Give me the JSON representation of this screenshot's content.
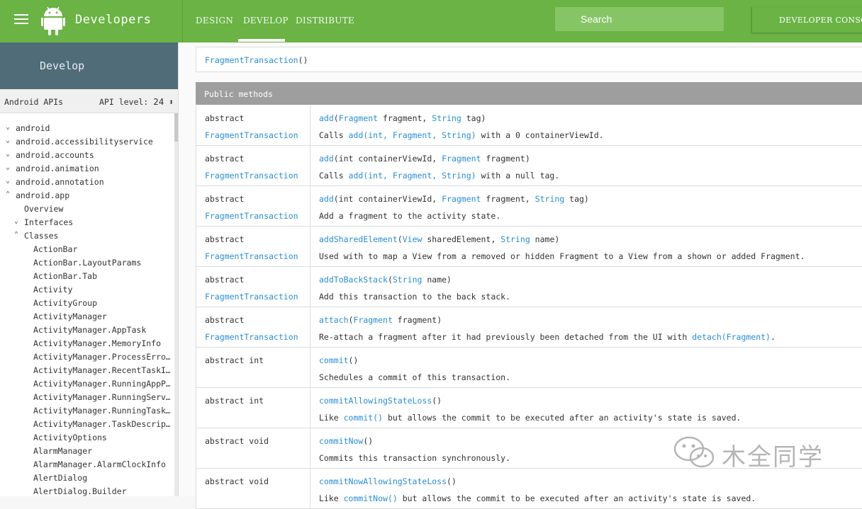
{
  "header": {
    "brand": "Developers",
    "tabs": [
      "DESIGN",
      "DEVELOP",
      "DISTRIBUTE"
    ],
    "active_tab": "DEVELOP",
    "search_placeholder": "Search",
    "console_label": "DEVELOPER CONSOLE",
    "color": "#6ab344"
  },
  "sidebar": {
    "section_title": "Develop",
    "api_label": "Android APIs",
    "api_level_label": "API level:",
    "api_level_value": "24",
    "items": [
      {
        "label": "android",
        "indent": 0,
        "chev": "down"
      },
      {
        "label": "android.accessibilityservice",
        "indent": 0,
        "chev": "down"
      },
      {
        "label": "android.accounts",
        "indent": 0,
        "chev": "down"
      },
      {
        "label": "android.animation",
        "indent": 0,
        "chev": "down"
      },
      {
        "label": "android.annotation",
        "indent": 0,
        "chev": "down"
      },
      {
        "label": "android.app",
        "indent": 0,
        "chev": "up"
      },
      {
        "label": "Overview",
        "indent": 1,
        "chev": ""
      },
      {
        "label": "Interfaces",
        "indent": 1,
        "chev": "down"
      },
      {
        "label": "Classes",
        "indent": 1,
        "chev": "up"
      },
      {
        "label": "ActionBar",
        "indent": 2,
        "chev": ""
      },
      {
        "label": "ActionBar.LayoutParams",
        "indent": 2,
        "chev": ""
      },
      {
        "label": "ActionBar.Tab",
        "indent": 2,
        "chev": ""
      },
      {
        "label": "Activity",
        "indent": 2,
        "chev": ""
      },
      {
        "label": "ActivityGroup",
        "indent": 2,
        "chev": ""
      },
      {
        "label": "ActivityManager",
        "indent": 2,
        "chev": ""
      },
      {
        "label": "ActivityManager.AppTask",
        "indent": 2,
        "chev": ""
      },
      {
        "label": "ActivityManager.MemoryInfo",
        "indent": 2,
        "chev": ""
      },
      {
        "label": "ActivityManager.ProcessErro…",
        "indent": 2,
        "chev": ""
      },
      {
        "label": "ActivityManager.RecentTaskI…",
        "indent": 2,
        "chev": ""
      },
      {
        "label": "ActivityManager.RunningAppP…",
        "indent": 2,
        "chev": ""
      },
      {
        "label": "ActivityManager.RunningServ…",
        "indent": 2,
        "chev": ""
      },
      {
        "label": "ActivityManager.RunningTask…",
        "indent": 2,
        "chev": ""
      },
      {
        "label": "ActivityManager.TaskDescrip…",
        "indent": 2,
        "chev": ""
      },
      {
        "label": "ActivityOptions",
        "indent": 2,
        "chev": ""
      },
      {
        "label": "AlarmManager",
        "indent": 2,
        "chev": ""
      },
      {
        "label": "AlarmManager.AlarmClockInfo",
        "indent": 2,
        "chev": ""
      },
      {
        "label": "AlertDialog",
        "indent": 2,
        "chev": ""
      },
      {
        "label": "AlertDialog.Builder",
        "indent": 2,
        "chev": ""
      }
    ]
  },
  "content": {
    "constructor": {
      "name": "FragmentTransaction",
      "suffix": "()"
    },
    "public_methods_title": "Public methods",
    "methods": [
      {
        "ret1": "abstract",
        "ret2": "FragmentTransaction",
        "sig": [
          [
            "add",
            "l"
          ],
          [
            "(",
            ""
          ],
          [
            "Fragment",
            "l"
          ],
          [
            " fragment, ",
            "b"
          ],
          [
            "String",
            "l"
          ],
          [
            " tag",
            "b"
          ],
          [
            ")",
            ""
          ]
        ],
        "desc": [
          [
            "Calls ",
            ""
          ],
          [
            "add(int, Fragment, String)",
            "l"
          ],
          [
            " with a 0 containerViewId.",
            ""
          ]
        ]
      },
      {
        "ret1": "abstract",
        "ret2": "FragmentTransaction",
        "sig": [
          [
            "add",
            "l"
          ],
          [
            "(int containerViewId, ",
            ""
          ],
          [
            "Fragment",
            "l"
          ],
          [
            " fragment",
            ""
          ],
          [
            ")",
            ""
          ]
        ],
        "desc": [
          [
            "Calls ",
            ""
          ],
          [
            "add(int, Fragment, String)",
            "l"
          ],
          [
            " with a null tag.",
            ""
          ]
        ]
      },
      {
        "ret1": "abstract",
        "ret2": "FragmentTransaction",
        "sig": [
          [
            "add",
            "l"
          ],
          [
            "(int containerViewId, ",
            ""
          ],
          [
            "Fragment",
            "l"
          ],
          [
            " fragment, ",
            ""
          ],
          [
            "String",
            "l"
          ],
          [
            " tag",
            ""
          ],
          [
            ")",
            ""
          ]
        ],
        "desc": [
          [
            "Add a fragment to the activity state.",
            ""
          ]
        ]
      },
      {
        "ret1": "abstract",
        "ret2": "FragmentTransaction",
        "sig": [
          [
            "addSharedElement",
            "l"
          ],
          [
            "(",
            ""
          ],
          [
            "View",
            "l"
          ],
          [
            " sharedElement, ",
            ""
          ],
          [
            "String",
            "l"
          ],
          [
            " name",
            ""
          ],
          [
            ")",
            ""
          ]
        ],
        "desc": [
          [
            "Used with to map a View from a removed or hidden Fragment to a View from a shown or added Fragment.",
            ""
          ]
        ]
      },
      {
        "ret1": "abstract",
        "ret2": "FragmentTransaction",
        "sig": [
          [
            "addToBackStack",
            "l"
          ],
          [
            "(",
            ""
          ],
          [
            "String",
            "l"
          ],
          [
            " name",
            ""
          ],
          [
            ")",
            ""
          ]
        ],
        "desc": [
          [
            "Add this transaction to the back stack.",
            ""
          ]
        ]
      },
      {
        "ret1": "abstract",
        "ret2": "FragmentTransaction",
        "sig": [
          [
            "attach",
            "l"
          ],
          [
            "(",
            ""
          ],
          [
            "Fragment",
            "l"
          ],
          [
            " fragment",
            ""
          ],
          [
            ")",
            ""
          ]
        ],
        "desc": [
          [
            "Re-attach a fragment after it had previously been detached from the UI with ",
            ""
          ],
          [
            "detach(Fragment)",
            "l"
          ],
          [
            ".",
            ""
          ]
        ]
      },
      {
        "ret1": "abstract int",
        "ret2": "",
        "sig": [
          [
            "commit",
            "l"
          ],
          [
            "()",
            ""
          ]
        ],
        "desc": [
          [
            "Schedules a commit of this transaction.",
            ""
          ]
        ]
      },
      {
        "ret1": "abstract int",
        "ret2": "",
        "sig": [
          [
            "commitAllowingStateLoss",
            "l"
          ],
          [
            "()",
            ""
          ]
        ],
        "desc": [
          [
            "Like ",
            ""
          ],
          [
            "commit()",
            "l"
          ],
          [
            " but allows the commit to be executed after an activity's state is saved.",
            ""
          ]
        ]
      },
      {
        "ret1": "abstract void",
        "ret2": "",
        "sig": [
          [
            "commitNow",
            "l"
          ],
          [
            "()",
            ""
          ]
        ],
        "desc": [
          [
            "Commits this transaction synchronously.",
            ""
          ]
        ]
      },
      {
        "ret1": "abstract void",
        "ret2": "",
        "sig": [
          [
            "commitNowAllowingStateLoss",
            "l"
          ],
          [
            "()",
            ""
          ]
        ],
        "desc": [
          [
            "Like ",
            ""
          ],
          [
            "commitNow()",
            "l"
          ],
          [
            " but allows the commit to be executed after an activity's state is saved.",
            ""
          ]
        ]
      }
    ]
  },
  "watermark": "木全同学",
  "icons": [
    "menu-icon",
    "android-logo-icon",
    "chevron-icon",
    "wechat-icon"
  ],
  "colors": {
    "link": "#2a8ed4",
    "sidebar_header": "#506c79",
    "table_header": "#9e9e9e"
  }
}
